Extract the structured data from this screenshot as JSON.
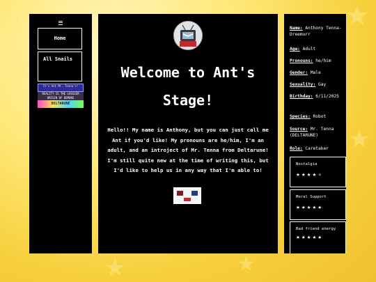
{
  "nav": {
    "home": "Home",
    "snails": "All Snails",
    "banner1": "It's Ant Mr. Tenna's!",
    "banner2": "REALITY IS THE LOSSIER ORIGIN OF DEMONS",
    "banner3": "DELTARUNE"
  },
  "main": {
    "title_line1": "Welcome to Ant's",
    "title_line2": "Stage!",
    "intro": "Hello!! My name is Anthony, but you can just call me Ant if you'd like! My pronouns are he/him, I'm an adult, and an introject of Mr. Tenna from Deltarune! I'm still quite new at the time of writing this, but I'd like to help us in any way that I'm able to!",
    "stamp_text": "Tenna"
  },
  "profile": [
    {
      "label": "Name:",
      "value": "Anthony Tenna-Dreemurr"
    },
    {
      "label": "Age:",
      "value": "Adult"
    },
    {
      "label": "Pronouns:",
      "value": "he/him"
    },
    {
      "label": "Gender:",
      "value": "Male"
    },
    {
      "label": "Sexuality:",
      "value": "Gay"
    },
    {
      "label": "Birthday:",
      "value": "6/11/2025"
    },
    {
      "label": "Species:",
      "value": "Robot"
    },
    {
      "label": "Source:",
      "value": "Mr. Tenna (DELTARUNE)"
    },
    {
      "label": "Role:",
      "value": "Caretaker"
    }
  ],
  "meters": [
    {
      "label": "Nostalgia",
      "rating": 4,
      "max": 5
    },
    {
      "label": "Moral Support",
      "rating": 5,
      "max": 5
    },
    {
      "label": "Bad friend energy",
      "rating": 5,
      "max": 5
    }
  ],
  "colors": {
    "panel": "#000000",
    "background": "#f6cf3a",
    "text": "#ffffff"
  }
}
